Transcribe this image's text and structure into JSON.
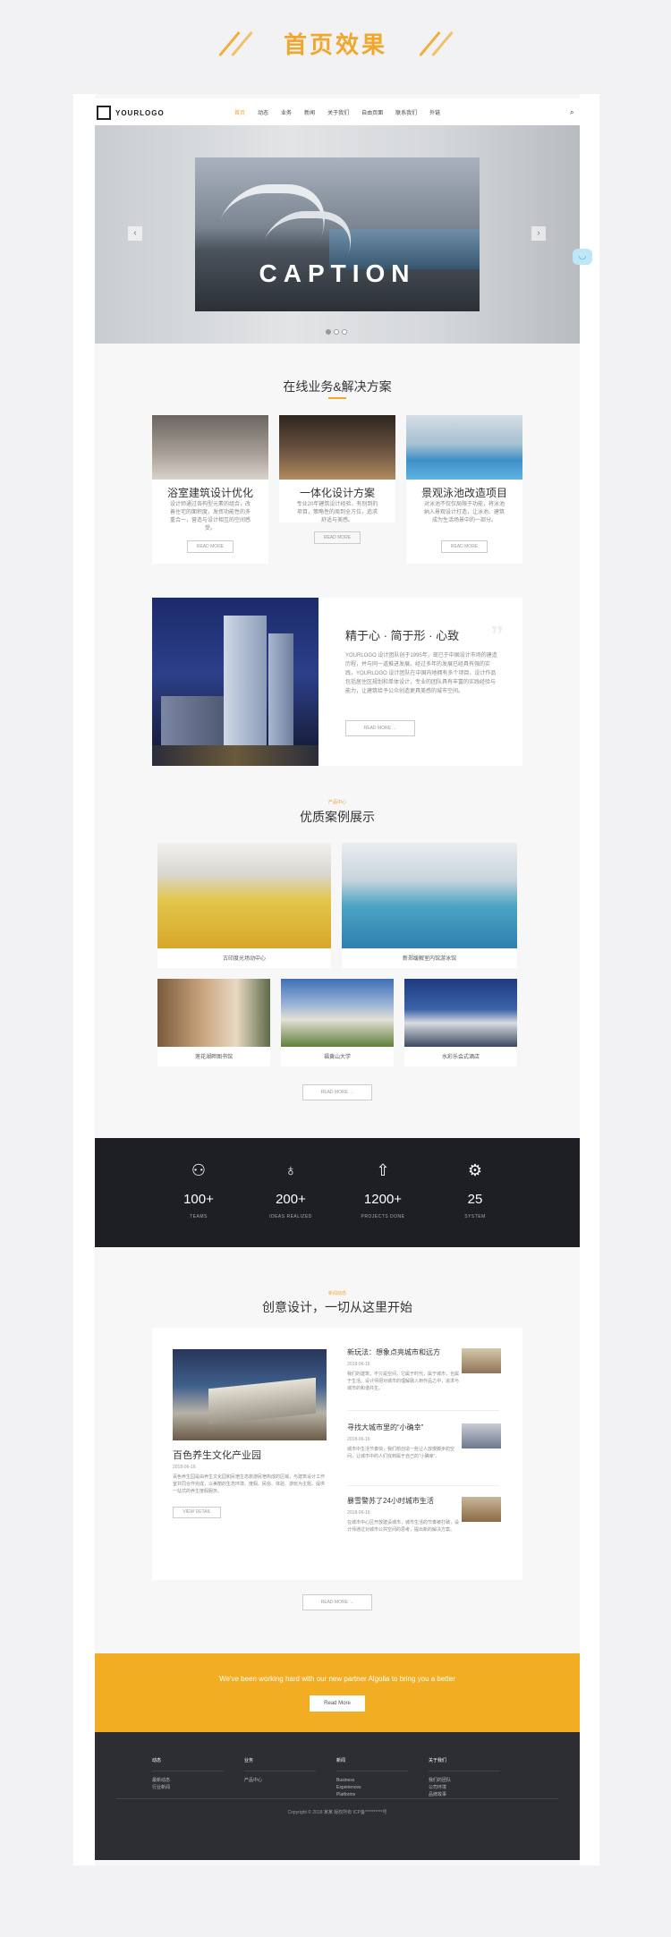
{
  "page_heading": "首页效果",
  "nav": {
    "logo": "YOURLOGO",
    "items": [
      "首页",
      "动态",
      "业务",
      "新闻",
      "关于我们",
      "自由页面",
      "联系我们",
      "外链"
    ]
  },
  "hero": {
    "caption": "CAPTION",
    "prev": "‹",
    "next": "›"
  },
  "services": {
    "title": "在线业务&解决方案",
    "items": [
      {
        "title": "浴室建筑设计优化",
        "desc": "设计师通过各构型元素的组合，改善住宅的面积度，发挥功能性的多重合一，营造与设计相互的空间感受。",
        "btn": "READ MORE"
      },
      {
        "title": "一体化设计方案",
        "desc": "专业20年建筑设计经验，有别到的项目，策略性的周到全方位，追求舒适与美感。",
        "btn": "READ MORE"
      },
      {
        "title": "景观泳池改造项目",
        "desc": "对泳池不仅仅局限于功能，将泳池纳入景观设计打造，让泳池、建筑成为生活场景中的一部分。",
        "btn": "READ MORE"
      }
    ]
  },
  "about": {
    "title": "精于心 · 简于形 · 心致",
    "desc": "YOURLOGO 设计团队创于1995年，现已于中国设计市场的建造历程，并与同一道推进发展。经过多年的发展已经具有强的实践，YOURLOGO 设计团队在中国内地拥有多个项目，设计作品包括居住区规划和单体设计，专业的团队具有丰富的实践经验与能力，让建筑给予公众创造更具美感的城市空间。",
    "btn": "READ MORE →"
  },
  "cases": {
    "tag": "产品中心",
    "title": "优质案例展示",
    "items": [
      {
        "label": "古印度光场动中心"
      },
      {
        "label": "新郑缓解室内馆游泳馆"
      },
      {
        "label": "莲花湖畔图书馆"
      },
      {
        "label": "福黄山大学"
      },
      {
        "label": "水彩乐会式酒店"
      }
    ],
    "more": "READ MORE →"
  },
  "stats": [
    {
      "icon": "users-icon",
      "num": "100+",
      "label": "TEAMS"
    },
    {
      "icon": "bulb-icon",
      "num": "200+",
      "label": "IDEAS REALIZED"
    },
    {
      "icon": "rocket-icon",
      "num": "1200+",
      "label": "PROJECTS DONE"
    },
    {
      "icon": "gear-icon",
      "num": "25",
      "label": "SYSTEM"
    }
  ],
  "news": {
    "tag": "新闻动态",
    "title": "创意设计，一切从这里开始",
    "big": {
      "title": "百色养生文化产业园",
      "date": "2018-06-16",
      "desc": "百色养生园是由养生文化园和民宿生态旅游民宿构成的区域，与建筑设计工作室共同合作完成，以美丽的生态环境、度假、民俗、体验、游玩为主题，提供一站式的养生度假服务。",
      "btn": "VIEW DETAIL"
    },
    "items": [
      {
        "title": "新玩法：想象点亮城市和远方",
        "date": "2018-06-16",
        "desc": "我们的建筑，不只是空间，它属于时代，属于城市，也属于生活。设计师把对城市的理解融入到作品之中，追求与城市的和谐共生。"
      },
      {
        "title": "寻找大城市里的“小确幸”",
        "date": "2018-06-16",
        "desc": "城市中生活节奏快，我们想创造一些让人放慢脚步的空间，让城市中的人们找到属于自己的“小确幸”。"
      },
      {
        "title": "暴雪警苏了24小时城市生活",
        "date": "2018-06-16",
        "desc": "在城市中心区开放建设城市，城市生活的节奏被打破，设计师通过对城市公共空间的思考，提出新的解决方案。"
      }
    ],
    "more": "READ MORE →"
  },
  "cta": {
    "text": "We've been working hard with our new partner Algolia to bring you a better",
    "btn": "Read More"
  },
  "footer": {
    "cols": [
      {
        "head": "动态",
        "items": [
          "最新动态",
          "行业新闻"
        ]
      },
      {
        "head": "业务",
        "items": [
          "产品中心"
        ]
      },
      {
        "head": "新闻",
        "items": [
          "Business",
          "Experiences",
          "Platforms"
        ]
      },
      {
        "head": "关于我们",
        "items": [
          "我们的团队",
          "公司环境",
          "品牌故事"
        ]
      }
    ],
    "copyright": "Copyright © 2018 某某 版权所有 ICP备**********号"
  }
}
